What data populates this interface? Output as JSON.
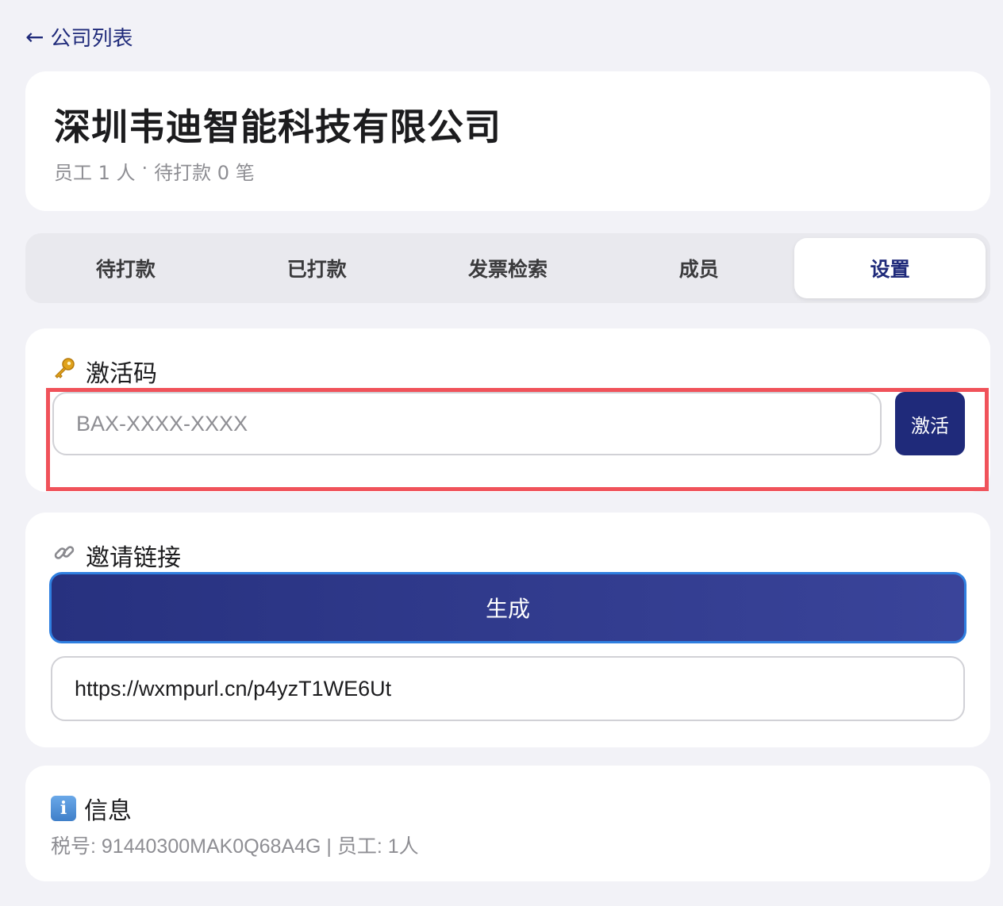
{
  "nav": {
    "back_arrow": "←",
    "back_label": "公司列表"
  },
  "company": {
    "name": "深圳韦迪智能科技有限公司",
    "employees_label": "员工 1 人",
    "separator": "·",
    "pending_label": "待打款 0 笔"
  },
  "tabs": [
    {
      "label": "待打款",
      "active": false
    },
    {
      "label": "已打款",
      "active": false
    },
    {
      "label": "发票检索",
      "active": false
    },
    {
      "label": "成员",
      "active": false
    },
    {
      "label": "设置",
      "active": true
    }
  ],
  "activation": {
    "icon": "key-icon",
    "title": "激活码",
    "placeholder": "BAX-XXXX-XXXX",
    "value": "",
    "button_label": "激活"
  },
  "invite": {
    "icon": "link-icon",
    "title": "邀请链接",
    "button_label": "生成",
    "link_value": "https://wxmpurl.cn/p4yzT1WE6Ut"
  },
  "info": {
    "icon": "info-icon",
    "title": "信息",
    "detail": "税号: 91440300MAK0Q68A4G | 员工: 1人"
  },
  "colors": {
    "accent": "#1f2a7a",
    "highlight": "#f0525a",
    "background": "#f2f2f7",
    "muted_text": "#8e8e93"
  }
}
